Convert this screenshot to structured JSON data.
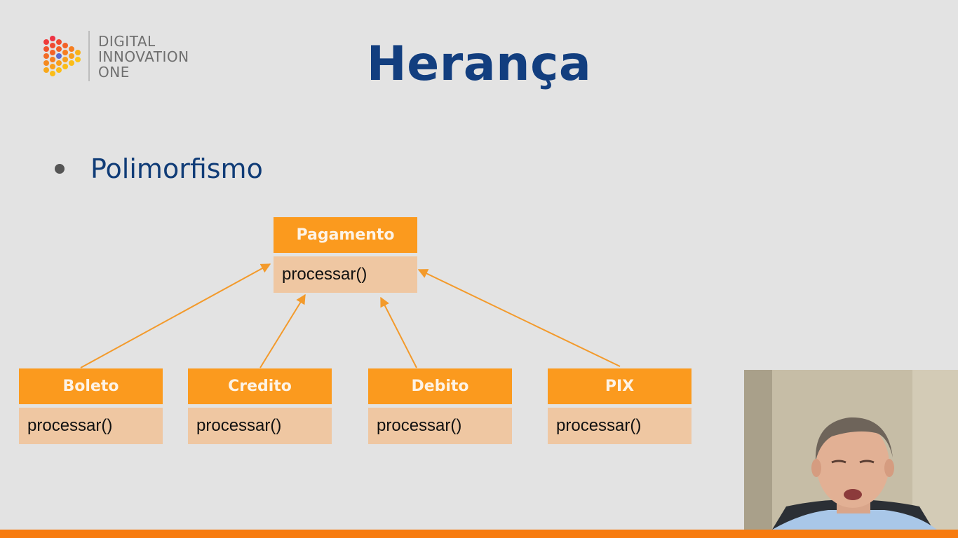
{
  "logo": {
    "line1": "DIGITAL",
    "line2": "INNOVATION",
    "line3": "ONE"
  },
  "slide": {
    "title": "Herança",
    "bullet": "Polimorfismo"
  },
  "diagram": {
    "parent": {
      "name": "Pagamento",
      "method": "processar()"
    },
    "children": [
      {
        "name": "Boleto",
        "method": "processar()"
      },
      {
        "name": "Credito",
        "method": "processar()"
      },
      {
        "name": "Debito",
        "method": "processar()"
      },
      {
        "name": "PIX",
        "method": "processar()"
      }
    ]
  },
  "colors": {
    "title": "#123e7f",
    "class_header": "#fb9a1e",
    "class_body": "#efc7a2",
    "arrow": "#f39a2b",
    "bottom_bar": "#f77b0f"
  }
}
